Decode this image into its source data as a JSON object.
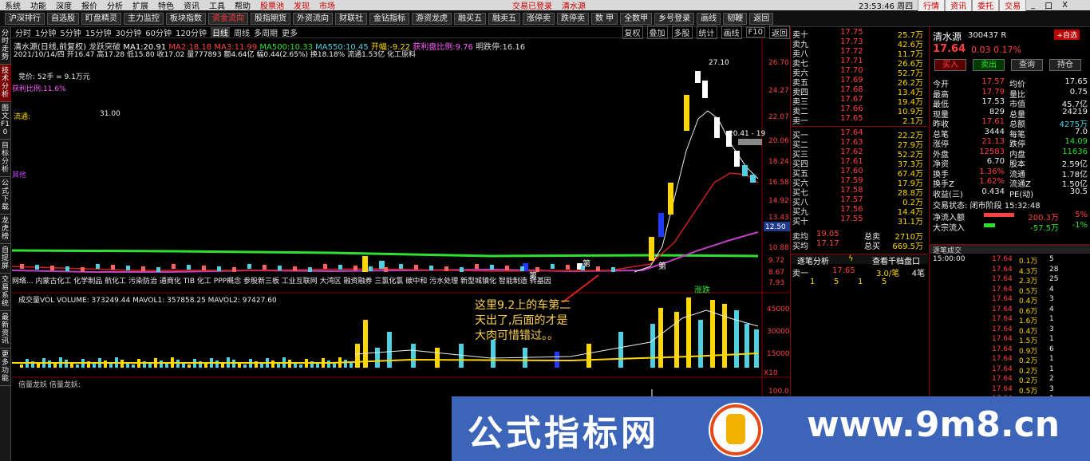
{
  "menubar": {
    "items": [
      "系统",
      "功能",
      "深度",
      "报价",
      "分析",
      "扩展",
      "特色",
      "资讯",
      "工具",
      "帮助"
    ],
    "extras": [
      "股票池",
      "发现",
      "市场"
    ],
    "login_text": "交易已登录",
    "stock_name": "清水源",
    "datetime": "23:53:46 周四",
    "right_buttons": [
      "行情",
      "资讯",
      "委托",
      "交易"
    ],
    "win_controls": [
      "_",
      "口",
      "X"
    ]
  },
  "toolbar": {
    "buttons": [
      "沪深排行",
      "自选股",
      "盯盘精灵",
      "主力监控",
      "板块指数",
      "资金流向",
      "股指期货",
      "外资流向",
      "财联社",
      "金钻指标",
      "游资龙虎",
      "融买五",
      "融卖五",
      "涨停卖",
      "跌停卖",
      "数 甲",
      "全数甲",
      "乡号登录",
      "画线",
      "韧鞭",
      "返回"
    ],
    "highlight": "资金流向"
  },
  "lefttabs": [
    "分时走势",
    "技术分析",
    "图文F10",
    "目标分析",
    "公式下载",
    "龙虎榜",
    "自提屏",
    "交易系统",
    "最新资讯",
    "更多功能"
  ],
  "periodbar": {
    "items": [
      "分时",
      "1分钟",
      "5分钟",
      "15分钟",
      "30分钟",
      "60分钟",
      "120分钟",
      "日线",
      "周线",
      "多周期",
      "更多"
    ],
    "active": "日线",
    "right": [
      "复权",
      "叠加",
      "多股",
      "统计",
      "画线",
      "F10",
      "返回"
    ]
  },
  "chart": {
    "header": "清水源(日线,前复权)",
    "ma": [
      {
        "label": "龙跃突破",
        "value": ""
      },
      {
        "label": "MA1:",
        "value": "20.91"
      },
      {
        "label": "MA2:",
        "value": "18.18"
      },
      {
        "label": "MA3:",
        "value": "11.99"
      },
      {
        "label": "MA500:",
        "value": "10.33"
      },
      {
        "label": "MA550:",
        "value": "10.45"
      },
      {
        "label": "开幅:",
        "value": "-9.22"
      },
      {
        "label": "获利盘比例:",
        "value": "9.76"
      },
      {
        "label": "明跌停:",
        "value": "16.16"
      }
    ],
    "info": "2021/10/14/四 开16.47 高17.28 低15.80 收17.02 量777893 额4.64亿 幅0.44(2.65%) 换18.18% 流通1.53亿 化工原料",
    "left_notes": [
      "竞价: 52手 = 9.1万元",
      "获利比例:11.6%"
    ],
    "flow_label": "流通:",
    "flow_value": "31.00",
    "other_label": "其他",
    "bottom_text": "网络... 内蒙古化工 化学制品 航化工 污染防治 通商化 TIB 化工 PPP概念 参股新三板 工业互联网 大湾区 融资融券 三氯化氯 碳中和 污水处理 新型城镇化 智能制造 转基因",
    "peak_label": "27.10",
    "low_label": "20.41 - 19",
    "labels": [
      "第",
      "第",
      "第"
    ],
    "zhang_label": "涨跌",
    "yticks": [
      "26.70",
      "24.27",
      "22.07",
      "20.06",
      "18.24",
      "16.58",
      "14.92",
      "13.43",
      "10.88",
      "9.72",
      "8.67",
      "7.93"
    ],
    "price_tag": "12.50",
    "vol_header": "成交量VOL VOLUME: 373249.44 MAVOL1: 357858.25 MAVOL2: 97427.60",
    "vol_yticks": [
      "45000",
      "30000",
      "15000"
    ],
    "vol_unit": "X10",
    "bottom_ind": "倍量龙妖 倍量龙妖:",
    "bottom_ind_tick": "100.0",
    "chart_data": {
      "type": "candlestick",
      "last_close": 17.64,
      "peak": 27.1,
      "ylim": [
        7.93,
        26.7
      ]
    }
  },
  "annotation": "这里9.2上的车第二天出了,后面的才是大肉可惜错过。。",
  "rightpanel": {
    "asks": [
      {
        "l": "卖十",
        "p": "17.75",
        "v": "25.7万"
      },
      {
        "l": "卖九",
        "p": "17.73",
        "v": "42.6万"
      },
      {
        "l": "卖八",
        "p": "17.72",
        "v": "11.7万"
      },
      {
        "l": "卖七",
        "p": "17.71",
        "v": "26.6万"
      },
      {
        "l": "卖六",
        "p": "17.70",
        "v": "52.7万"
      },
      {
        "l": "卖五",
        "p": "17.69",
        "v": "26.2万"
      },
      {
        "l": "卖四",
        "p": "17.68",
        "v": "13.4万"
      },
      {
        "l": "卖三",
        "p": "17.67",
        "v": "19.4万"
      },
      {
        "l": "卖二",
        "p": "17.66",
        "v": "10.9万"
      },
      {
        "l": "卖一",
        "p": "17.65",
        "v": "2.1万"
      }
    ],
    "bids": [
      {
        "l": "买一",
        "p": "17.64",
        "v": "22.2万"
      },
      {
        "l": "买二",
        "p": "17.63",
        "v": "27.9万"
      },
      {
        "l": "买三",
        "p": "17.62",
        "v": "52.2万"
      },
      {
        "l": "买四",
        "p": "17.61",
        "v": "37.3万"
      },
      {
        "l": "买五",
        "p": "17.60",
        "v": "67.4万"
      },
      {
        "l": "买六",
        "p": "17.59",
        "v": "17.9万"
      },
      {
        "l": "买七",
        "p": "17.58",
        "v": "28.8万"
      },
      {
        "l": "买八",
        "p": "17.57",
        "v": "0.2万"
      },
      {
        "l": "买九",
        "p": "17.56",
        "v": "14.4万"
      },
      {
        "l": "买十",
        "p": "17.55",
        "v": "31.1万"
      }
    ],
    "avg_sell": {
      "label": "卖均",
      "p": "19.05",
      "l2": "总卖",
      "v": "2710万"
    },
    "avg_buy": {
      "label": "买均",
      "p": "17.17",
      "l2": "总买",
      "v": "669.5万"
    },
    "tick_tabs": [
      "逐笔分析",
      "ϟ",
      "查看千档盘口"
    ],
    "tick_row": {
      "l": "卖一",
      "p": "17.65",
      "v": "3.0/笔",
      "n": "4笔"
    },
    "tick_nums": [
      "1",
      "5",
      "1",
      "5"
    ],
    "stock": {
      "name": "清水源",
      "code": "300437",
      "suffix": "R",
      "price": "17.64",
      "change": "0.03",
      "pct": "0.17%",
      "add": "+自选"
    },
    "trade_buttons": [
      "买入",
      "卖出",
      "查询",
      "持仓"
    ],
    "quotes": [
      {
        "a": "今开",
        "av": "17.57",
        "b": "均价",
        "bv": "17.65"
      },
      {
        "a": "最高",
        "av": "17.79",
        "b": "量比",
        "bv": "0.75"
      },
      {
        "a": "最低",
        "av": "17.53",
        "b": "市值",
        "bv": "45.7亿"
      },
      {
        "a": "现量",
        "av": "829",
        "b": "总量",
        "bv": "24219"
      },
      {
        "a": "昨收",
        "av": "17.61",
        "b": "总额",
        "bv": "4275万"
      },
      {
        "a": "总笔",
        "av": "3444",
        "b": "每笔",
        "bv": "7.0"
      },
      {
        "a": "涨停",
        "av": "21.13",
        "b": "跌停",
        "bv": "14.09"
      },
      {
        "a": "外盘",
        "av": "12583",
        "b": "内盘",
        "bv": "11636"
      },
      {
        "a": "净资",
        "av": "6.70",
        "b": "股本",
        "bv": "2.59亿"
      },
      {
        "a": "换手",
        "av": "1.36%",
        "b": "流通",
        "bv": "1.78亿"
      },
      {
        "a": "换手Z",
        "av": "1.62%",
        "b": "流通Z",
        "bv": "1.50亿"
      },
      {
        "a": "收益(三)",
        "av": "0.434",
        "b": "PE(动)",
        "bv": "30.5"
      }
    ],
    "status": "交易状态: 闭市阶段 15:32:48",
    "netflow": [
      {
        "l": "净流入额",
        "v": "200.3万",
        "pct": "5%"
      },
      {
        "l": "大宗流入",
        "v": "-57.5万",
        "pct": "-1%"
      }
    ],
    "ticklist_title": "逐笔成交",
    "ticks": [
      {
        "t": "15:00:00",
        "p": "17.64",
        "v": "0.1万",
        "n": "5"
      },
      {
        "t": "",
        "p": "17.64",
        "v": "4.3万",
        "n": "28"
      },
      {
        "t": "",
        "p": "17.64",
        "v": "2.3万",
        "n": "25"
      },
      {
        "t": "",
        "p": "17.64",
        "v": "0.5万",
        "n": "4"
      },
      {
        "t": "",
        "p": "17.64",
        "v": "0.4万",
        "n": "3"
      },
      {
        "t": "",
        "p": "17.64",
        "v": "0.6万",
        "n": "4"
      },
      {
        "t": "",
        "p": "17.64",
        "v": "1.6万",
        "n": "1"
      },
      {
        "t": "",
        "p": "17.64",
        "v": "0.4万",
        "n": "3"
      },
      {
        "t": "",
        "p": "17.64",
        "v": "1.5万",
        "n": "1"
      },
      {
        "t": "",
        "p": "17.64",
        "v": "0.9万",
        "n": "6"
      },
      {
        "t": "",
        "p": "17.64",
        "v": "0.2万",
        "n": "1"
      },
      {
        "t": "",
        "p": "17.64",
        "v": "0.2万",
        "n": "1"
      },
      {
        "t": "",
        "p": "17.64",
        "v": "0.2万",
        "n": "2"
      },
      {
        "t": "",
        "p": "17.64",
        "v": "0.5万",
        "n": "3"
      },
      {
        "t": "",
        "p": "17.64",
        "v": "0.1万",
        "n": "1"
      },
      {
        "t": "",
        "p": "17.64",
        "v": "0.4万",
        "n": "3"
      },
      {
        "t": "",
        "p": "17.64",
        "v": "0.7万",
        "n": "5"
      },
      {
        "t": "",
        "p": "17.64",
        "v": "0.4万",
        "n": "2"
      },
      {
        "t": "",
        "p": "17.64",
        "v": "0.3万",
        "n": "2"
      }
    ]
  },
  "watermark": {
    "text": "公式指标网",
    "url": "www.9m8.cn",
    "colors": {
      "bg": "#3c64b8",
      "accent": "#e64a19"
    }
  }
}
